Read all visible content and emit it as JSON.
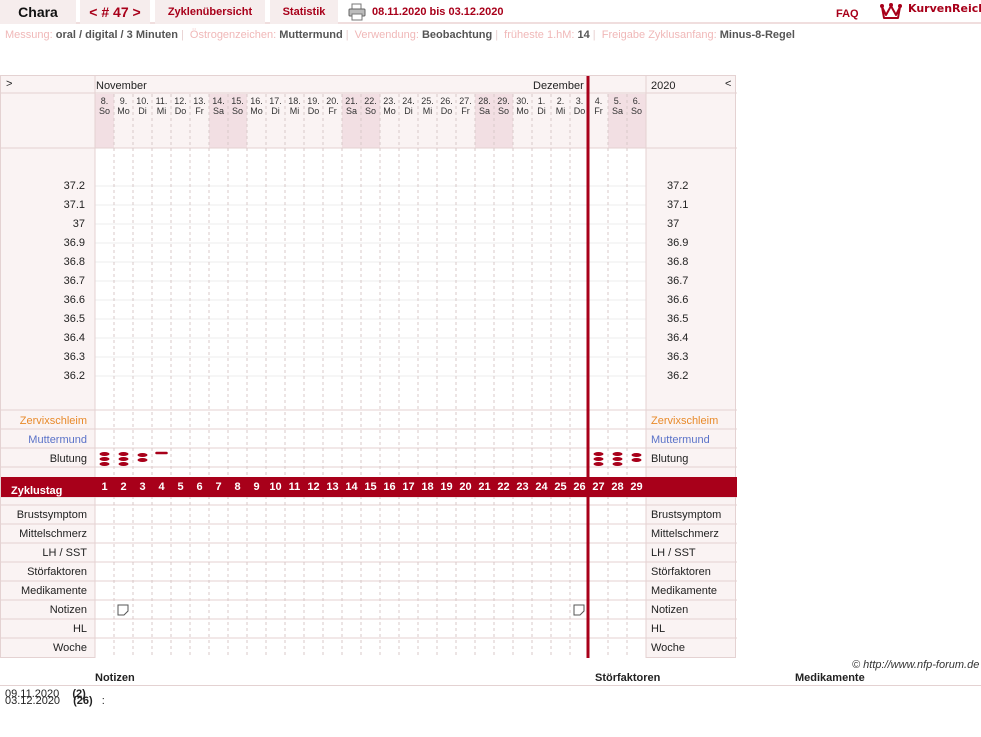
{
  "header": {
    "user_name": "Chara",
    "cycle_number": "< # 47 >",
    "tab_overview": "Zyklenübersicht",
    "tab_statistics": "Statistik",
    "date_range": "08.11.2020 bis 03.12.2020",
    "faq": "FAQ",
    "logo_text": "KurvenReich"
  },
  "info": [
    {
      "label": "Messung:",
      "value": "oral / digital / 3 Minuten"
    },
    {
      "label": "Östrogenzeichen:",
      "value": "Muttermund"
    },
    {
      "label": "Verwendung:",
      "value": "Beobachtung"
    },
    {
      "label": "früheste 1.hM:",
      "value": "14"
    },
    {
      "label": "Freigabe Zyklusanfang:",
      "value": "Minus-8-Regel"
    }
  ],
  "chart": {
    "nav_prev": ">",
    "nav_next": "<",
    "year": "2020",
    "month_nov": "November",
    "month_dec": "Dezember",
    "days": [
      {
        "d": "8.",
        "w": "So",
        "weekend": true
      },
      {
        "d": "9.",
        "w": "Mo"
      },
      {
        "d": "10.",
        "w": "Di"
      },
      {
        "d": "11.",
        "w": "Mi"
      },
      {
        "d": "12.",
        "w": "Do"
      },
      {
        "d": "13.",
        "w": "Fr"
      },
      {
        "d": "14.",
        "w": "Sa",
        "weekend": true
      },
      {
        "d": "15.",
        "w": "So",
        "weekend": true
      },
      {
        "d": "16.",
        "w": "Mo"
      },
      {
        "d": "17.",
        "w": "Di"
      },
      {
        "d": "18.",
        "w": "Mi"
      },
      {
        "d": "19.",
        "w": "Do"
      },
      {
        "d": "20.",
        "w": "Fr"
      },
      {
        "d": "21.",
        "w": "Sa",
        "weekend": true
      },
      {
        "d": "22.",
        "w": "So",
        "weekend": true
      },
      {
        "d": "23.",
        "w": "Mo"
      },
      {
        "d": "24.",
        "w": "Di"
      },
      {
        "d": "25.",
        "w": "Mi"
      },
      {
        "d": "26.",
        "w": "Do"
      },
      {
        "d": "27.",
        "w": "Fr"
      },
      {
        "d": "28.",
        "w": "Sa",
        "weekend": true
      },
      {
        "d": "29.",
        "w": "So",
        "weekend": true
      },
      {
        "d": "30.",
        "w": "Mo"
      },
      {
        "d": "1.",
        "w": "Di"
      },
      {
        "d": "2.",
        "w": "Mi"
      },
      {
        "d": "3.",
        "w": "Do"
      },
      {
        "d": "4.",
        "w": "Fr",
        "next_cycle": true
      },
      {
        "d": "5.",
        "w": "Sa",
        "weekend": true,
        "next_cycle": true
      },
      {
        "d": "6.",
        "w": "So",
        "weekend": true,
        "next_cycle": true
      }
    ],
    "temperatures": [
      "37.2",
      "37.1",
      "37",
      "36.9",
      "36.8",
      "36.7",
      "36.6",
      "36.5",
      "36.4",
      "36.3",
      "36.2"
    ],
    "row_zervix": "Zervixschleim",
    "row_muttermund": "Muttermund",
    "row_blutung": "Blutung",
    "row_zyklustag": "Zyklustag",
    "bottom_rows": [
      "Brustsymptom",
      "Mittelschmerz",
      "LH / SST",
      "Störfaktoren",
      "Medikamente",
      "Notizen",
      "HL",
      "Woche"
    ],
    "cycle_days": [
      "1",
      "2",
      "3",
      "4",
      "5",
      "6",
      "7",
      "8",
      "9",
      "10",
      "11",
      "12",
      "13",
      "14",
      "15",
      "16",
      "17",
      "18",
      "19",
      "20",
      "21",
      "22",
      "23",
      "24",
      "25",
      "26",
      "27",
      "28",
      "29"
    ],
    "bleeding": [
      3,
      3,
      2,
      1,
      0,
      0,
      0,
      0,
      0,
      0,
      0,
      0,
      0,
      0,
      0,
      0,
      0,
      0,
      0,
      0,
      0,
      0,
      0,
      0,
      0,
      0,
      3,
      3,
      2
    ],
    "notes_days": [
      1,
      25
    ],
    "colors": {
      "accent": "#a8001a",
      "zervix": "#e88a2a",
      "muttermund": "#5a72c8",
      "weekend": "#f2dfe3"
    }
  },
  "footer": {
    "copyright": "© http://www.nfp-forum.de",
    "col_notizen": "Notizen",
    "col_stoerfaktoren": "Störfaktoren",
    "col_medikamente": "Medikamente",
    "notes": [
      {
        "date": "09.11.2020",
        "day": "(2)",
        "text": ""
      },
      {
        "date": "03.12.2020",
        "day": "(26)",
        "text": ":"
      }
    ]
  }
}
